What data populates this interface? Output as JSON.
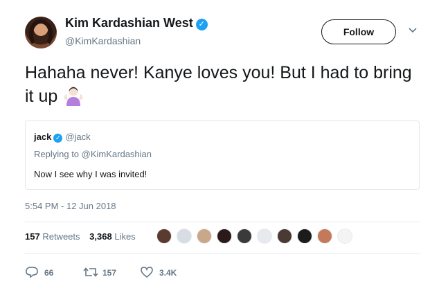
{
  "author": {
    "display_name": "Kim Kardashian West",
    "handle": "@KimKardashian",
    "avatar_icon": "profile-photo",
    "verified_icon": "verified-badge-icon"
  },
  "follow_label": "Follow",
  "tweet_text": "Hahaha never! Kanye loves you! But I had to bring it up",
  "tweet_emoji_icon": "person-raising-hands-emoji",
  "quote": {
    "name": "jack",
    "handle": "@jack",
    "replying_prefix": "Replying to ",
    "replying_to": "@KimKardashian",
    "text": "Now I see why I was invited!"
  },
  "timestamp": "5:54 PM - 12 Jun 2018",
  "stats": {
    "retweets_count": "157",
    "retweets_label": "Retweets",
    "likes_count": "3,368",
    "likes_label": "Likes"
  },
  "likers": [
    {
      "color": "#5a3b2e"
    },
    {
      "color": "#d8dde4"
    },
    {
      "color": "#c9a88a"
    },
    {
      "color": "#2b1a1a"
    },
    {
      "color": "#3a3a3a"
    },
    {
      "color": "#e8e8ef"
    },
    {
      "color": "#4a3a33"
    },
    {
      "color": "#1c1c1c"
    },
    {
      "color": "#c47a5a"
    },
    {
      "color": "#f4f4f4"
    }
  ],
  "actions": {
    "replies": "66",
    "retweets": "157",
    "likes": "3.4K"
  },
  "colors": {
    "accent": "#1da1f2",
    "text_primary": "#14171a",
    "text_secondary": "#657786",
    "border": "#e1e8ed"
  }
}
